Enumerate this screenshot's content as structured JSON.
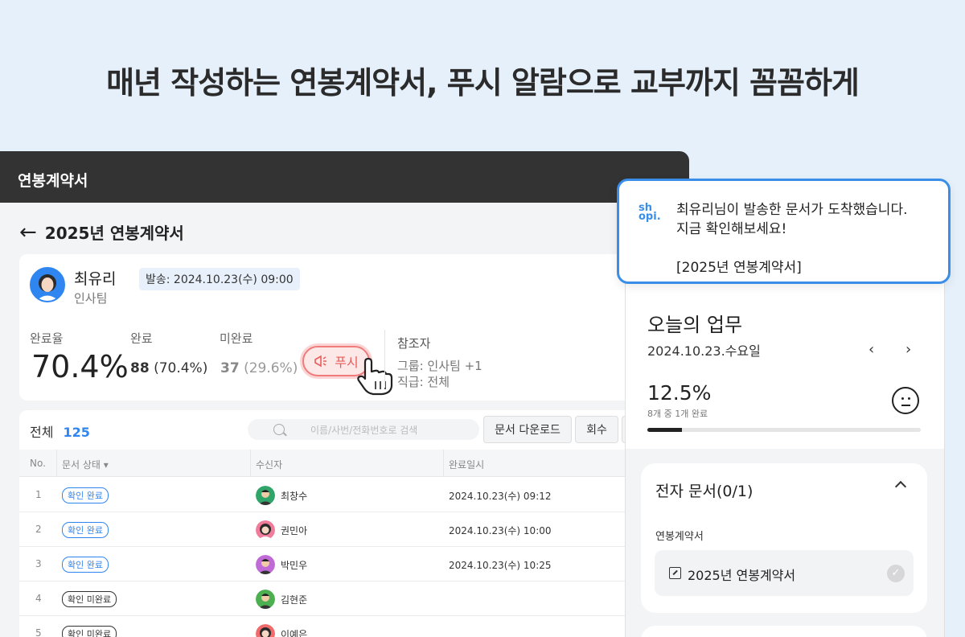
{
  "headline": "매년 작성하는 연봉계약서, 푸시 알람으로 교부까지 꼼꼼하게",
  "window": {
    "title": "연봉계약서",
    "page_title": "2025년 연봉계약서",
    "sender": {
      "name": "최유리",
      "team": "인사팀",
      "sent_badge": "발송: 2024.10.23(수) 09:00"
    },
    "stats": {
      "rate_label": "완료율",
      "rate_value": "70.4%",
      "done_label": "완료",
      "done_count": "88",
      "done_pct": "(70.4%)",
      "undone_label": "미완료",
      "undone_count": "37",
      "undone_pct": "(29.6%)"
    },
    "push_label": "푸시",
    "refs": {
      "title": "참조자",
      "group": "그룹: 인사팀 +1",
      "rank": "직급: 전체"
    },
    "table": {
      "total_label": "전체",
      "total_count": "125",
      "search_placeholder": "이름/사번/전화번호로 검색",
      "download_label": "문서 다운로드",
      "revoke_label": "회수",
      "headers": {
        "no": "No.",
        "status": "문서 상태 ▾",
        "recipient": "수신자",
        "completed_at": "완료일시"
      },
      "rows": [
        {
          "no": "1",
          "status": "확인 완료",
          "name": "최창수",
          "date": "2024.10.23(수) 09:12"
        },
        {
          "no": "2",
          "status": "확인 완료",
          "name": "권민아",
          "date": "2024.10.23(수) 10:00"
        },
        {
          "no": "3",
          "status": "확인 완료",
          "name": "박민우",
          "date": "2024.10.23(수) 10:25"
        },
        {
          "no": "4",
          "status": "확인 미완료",
          "name": "김현준",
          "date": ""
        },
        {
          "no": "5",
          "status": "확인 미완료",
          "name": "이예은",
          "date": ""
        }
      ]
    }
  },
  "notification": {
    "logo": "sh opi.",
    "line1": "최유리님이 발송한 문서가 도착했습니다.",
    "line2": "지금 확인해보세요!",
    "line3": "[2025년 연봉계약서]"
  },
  "mobile": {
    "title": "오늘의 업무",
    "date": "2024.10.23.수요일",
    "prev": "‹",
    "next": "›",
    "percent": "12.5%",
    "percent_sub": "8개 중 1개 완료",
    "progress": 0.125,
    "doc_section_title": "전자 문서(0/1)",
    "doc_category": "연봉계약서",
    "doc_name": "2025년 연봉계약서"
  },
  "colors": {
    "accent": "#2f86f0",
    "push": "#e95c5c",
    "header_bar": "#333333",
    "background": "#e6f0fb"
  }
}
